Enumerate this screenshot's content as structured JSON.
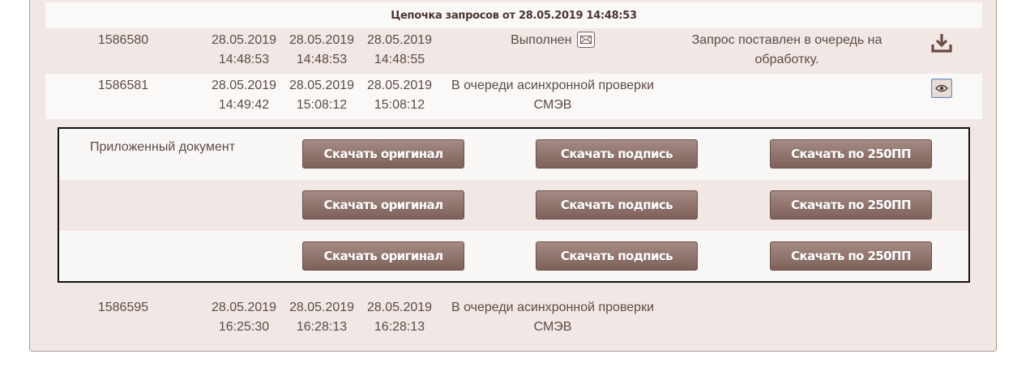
{
  "chain_title": "Цепочка запросов от 28.05.2019 14:48:53",
  "requests": [
    {
      "number": "1586580",
      "date1": [
        "28.05.2019",
        "14:48:53"
      ],
      "date2": [
        "28.05.2019",
        "14:48:53"
      ],
      "date3": [
        "28.05.2019",
        "14:48:55"
      ],
      "status": [
        "Выполнен",
        ""
      ],
      "note": [
        "Запрос поставлен в очередь на",
        "обработку."
      ],
      "action_icon": "download-icon",
      "status_icon": "envelope-icon"
    },
    {
      "number": "1586581",
      "date1": [
        "28.05.2019",
        "14:49:42"
      ],
      "date2": [
        "28.05.2019",
        "15:08:12"
      ],
      "date3": [
        "28.05.2019",
        "15:08:12"
      ],
      "status": [
        "В очереди асинхронной проверки",
        "СМЭВ"
      ],
      "action_icon": "eye-icon"
    },
    {
      "number": "1586595",
      "date1": [
        "28.05.2019",
        "16:25:30"
      ],
      "date2": [
        "28.05.2019",
        "16:28:13"
      ],
      "date3": [
        "28.05.2019",
        "16:28:13"
      ],
      "status": [
        "В очереди асинхронной проверки",
        "СМЭВ"
      ]
    }
  ],
  "documents": {
    "label": "Приложенный документ",
    "buttons": {
      "original": "Скачать оригинал",
      "signature": "Скачать подпись",
      "pp250": "Скачать по 250ПП"
    }
  },
  "colors": {
    "panel_bg": "#f1e8e6",
    "button_bg": "#8d716a",
    "text": "#5c4a43"
  }
}
